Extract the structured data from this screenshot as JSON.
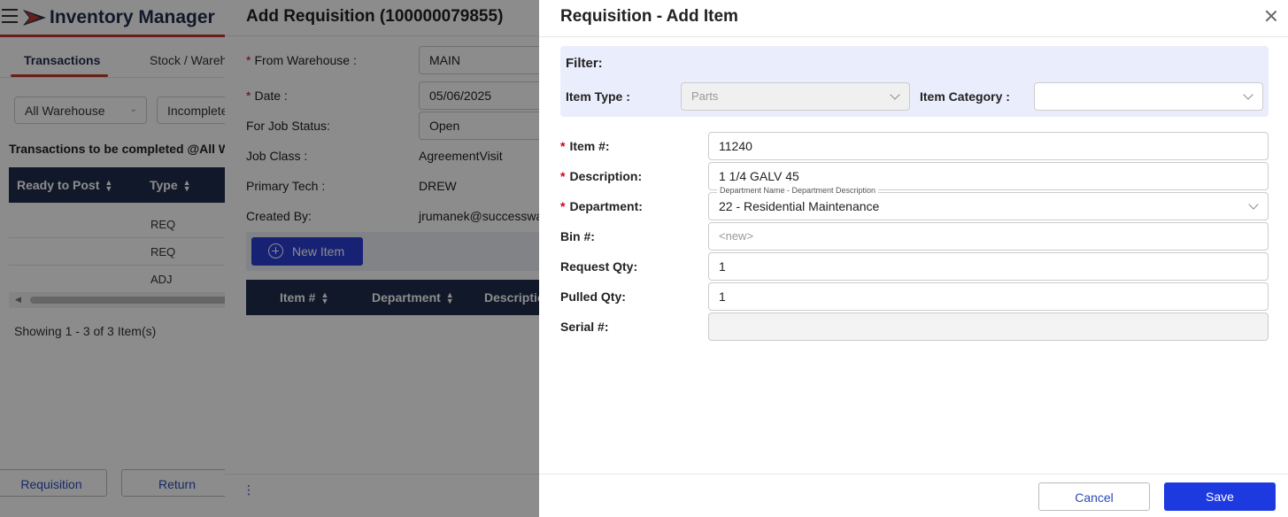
{
  "app": {
    "title": "Inventory Manager",
    "tabs": [
      "Transactions",
      "Stock / Wareh"
    ],
    "filters": {
      "warehouse": "All Warehouse",
      "status": "Incomplete"
    },
    "subtitle": "Transactions to be completed @All W",
    "table_headers": [
      "Ready to Post",
      "Type"
    ],
    "rows": [
      "REQ",
      "REQ",
      "ADJ"
    ],
    "showing": "Showing 1 - 3 of 3 Item(s)",
    "footer_buttons": [
      "Requisition",
      "Return"
    ]
  },
  "requisition": {
    "title": "Add Requisition (100000079855)",
    "fields": {
      "from_warehouse_label": "From Warehouse :",
      "from_warehouse_value": "MAIN",
      "date_label": "Date :",
      "date_value": "05/06/2025",
      "job_status_label": "For Job Status:",
      "job_status_value": "Open",
      "job_class_label": "Job Class :",
      "job_class_value": "AgreementVisit",
      "primary_tech_label": "Primary Tech :",
      "primary_tech_value": "DREW",
      "created_by_label": "Created By:",
      "created_by_value": "jrumanek@successwa"
    },
    "new_item_label": "New Item",
    "table_headers": [
      "Item #",
      "Department",
      "Descriptio"
    ],
    "footer_dots": "⋮"
  },
  "add_item": {
    "title": "Requisition - Add Item",
    "filter": {
      "title": "Filter:",
      "item_type_label": "Item Type :",
      "item_type_value": "Parts",
      "item_category_label": "Item Category :",
      "item_category_value": ""
    },
    "form": {
      "item_label": "Item #:",
      "item_value": "11240",
      "description_label": "Description:",
      "description_value": "1 1/4 GALV 45",
      "department_label": "Department:",
      "department_float": "Department Name - Department Description",
      "department_value": "22 - Residential Maintenance",
      "bin_label": "Bin #:",
      "bin_placeholder": "<new>",
      "request_qty_label": "Request Qty:",
      "request_qty_value": "1",
      "pulled_qty_label": "Pulled Qty:",
      "pulled_qty_value": "1",
      "serial_label": "Serial #:",
      "serial_value": ""
    },
    "buttons": {
      "cancel": "Cancel",
      "save": "Save"
    }
  }
}
